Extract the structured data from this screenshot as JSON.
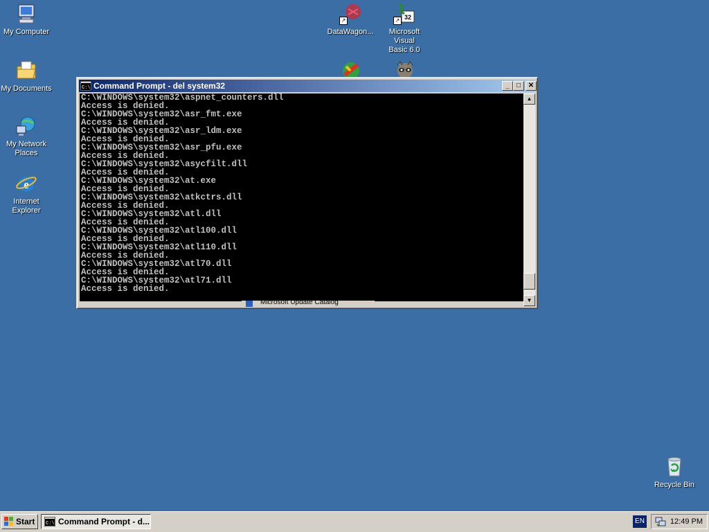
{
  "desktop": {
    "icons": [
      {
        "label": "My Computer",
        "icon": "my-computer-icon"
      },
      {
        "label": "My Documents",
        "icon": "my-documents-icon"
      },
      {
        "label": "My Network\nPlaces",
        "icon": "my-network-places-icon"
      },
      {
        "label": "Internet\nExplorer",
        "icon": "internet-explorer-icon"
      },
      {
        "label": "DataWagon...",
        "icon": "datawagon-icon"
      },
      {
        "label": "Microsoft Visual\nBasic 6.0",
        "icon": "visual-basic-icon"
      },
      {
        "label": "Recycle Bin",
        "icon": "recycle-bin-icon"
      }
    ],
    "background_color": "#3a6ea5"
  },
  "window": {
    "title": "Command Prompt - del system32",
    "icon": "command-prompt-icon",
    "buttons": {
      "minimize": "_",
      "maximize": "□",
      "close": "✕"
    },
    "console_lines": [
      "C:\\WINDOWS\\system32\\aspnet_counters.dll",
      "Access is denied.",
      "C:\\WINDOWS\\system32\\asr_fmt.exe",
      "Access is denied.",
      "C:\\WINDOWS\\system32\\asr_ldm.exe",
      "Access is denied.",
      "C:\\WINDOWS\\system32\\asr_pfu.exe",
      "Access is denied.",
      "C:\\WINDOWS\\system32\\asycfilt.dll",
      "Access is denied.",
      "C:\\WINDOWS\\system32\\at.exe",
      "Access is denied.",
      "C:\\WINDOWS\\system32\\atkctrs.dll",
      "Access is denied.",
      "C:\\WINDOWS\\system32\\atl.dll",
      "Access is denied.",
      "C:\\WINDOWS\\system32\\atl100.dll",
      "Access is denied.",
      "C:\\WINDOWS\\system32\\atl110.dll",
      "Access is denied.",
      "C:\\WINDOWS\\system32\\atl70.dll",
      "Access is denied.",
      "C:\\WINDOWS\\system32\\atl71.dll",
      "Access is denied."
    ],
    "behind_window_text": "Microsoft Update Catalog",
    "scroll_position": 0.97
  },
  "taskbar": {
    "start_label": "Start",
    "task_label": "Command Prompt - d...",
    "language": "EN",
    "clock": "12:49 PM"
  }
}
